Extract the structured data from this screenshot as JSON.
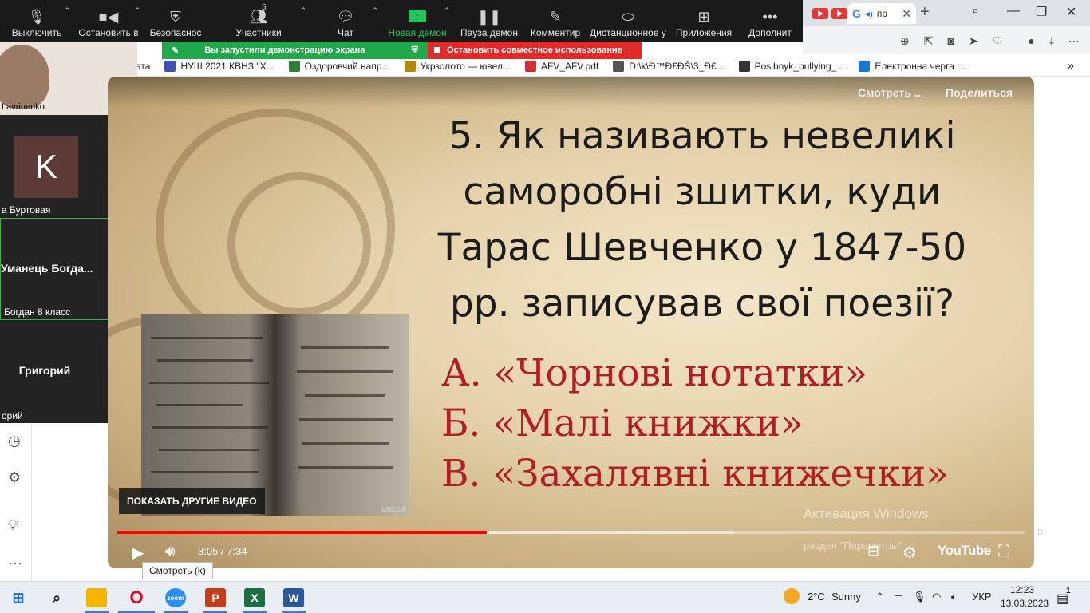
{
  "zoom_toolbar": {
    "items": [
      {
        "label": "Выключить",
        "icon": "mic-icon"
      },
      {
        "label": "Остановить в",
        "icon": "video-camera-icon"
      },
      {
        "label": "Безопаснос",
        "icon": "shield-icon"
      },
      {
        "label": "Участники",
        "icon": "participants-icon",
        "count": "5"
      },
      {
        "label": "Чат",
        "icon": "chat-icon"
      },
      {
        "label": "Новая демон",
        "icon": "share-screen-icon"
      },
      {
        "label": "Пауза демон",
        "icon": "pause-icon"
      },
      {
        "label": "Комментир",
        "icon": "pen-icon"
      },
      {
        "label": "Дистанционное у",
        "icon": "mouse-icon"
      },
      {
        "label": "Приложения",
        "icon": "apps-icon"
      },
      {
        "label": "Дополнит",
        "icon": "more-dots-icon"
      }
    ],
    "share_banner": "Вы запустили демонстрацию экрана",
    "stop_banner": "Остановить совместное использование",
    "accent_green": "#22c55e",
    "stop_red": "#e02b2b"
  },
  "participants": {
    "tile1_name": "Lavrinenko",
    "tile2_initial": "K",
    "tile2_name": "а Буртовая",
    "tile3_name": "Уманець  Богда...",
    "tile3_sub": "Богдан 8 класс",
    "tile4_name": "Григорий",
    "tile4_sub": "орий"
  },
  "browser": {
    "active_tab_title": "пр",
    "bookmarks": [
      {
        "label": "ата",
        "color": "#888888"
      },
      {
        "label": "НУШ 2021 КВНЗ \"Х...",
        "color": "#3f51b5"
      },
      {
        "label": "Оздоровчий напр...",
        "color": "#2e7d32"
      },
      {
        "label": "Укрзолото — ювел...",
        "color": "#b8860b"
      },
      {
        "label": "AFV_AFV.pdf",
        "color": "#d32f2f"
      },
      {
        "label": "D:\\k\\Ð™Ð£ÐŠ\\3_Ð£...",
        "color": "#555555"
      },
      {
        "label": "Posibnyk_bullying_...",
        "color": "#333333"
      },
      {
        "label": "Електронна черга :...",
        "color": "#1976d2"
      }
    ],
    "more_bookmarks": "»"
  },
  "video": {
    "top_right_watch": "Смотреть ...",
    "top_right_share": "Поделиться",
    "question_lines": [
      "5. Як називають невеликі",
      "саморобні зшитки, куди",
      "Тарас Шевченко у 1847-50",
      "рр. записував свої поезії?"
    ],
    "answers": [
      "А. «Чорнові нотатки»",
      "Б. «Малі книжки»",
      "В. «Захалявні книжечки»"
    ],
    "manuscript_watermark": "UNC.UA",
    "show_other_videos": "ПОКАЗАТЬ ДРУГИЕ ВИДЕО",
    "time": "3:05 / 7:34",
    "progress_played": 0.407,
    "progress_buffered": 0.68,
    "youtube_label": "YouTube",
    "activation_line1": "Активация Windows",
    "activation_line2": "раздел \"Параметры\"",
    "activation_end": "в",
    "tooltip": "Смотреть (k)",
    "answer_color": "#b11f24"
  },
  "taskbar": {
    "weather_temp": "2°C",
    "weather_text": "Sunny",
    "language": "УКР",
    "time": "12:23",
    "date": "13.03.2023",
    "notification_count": "1"
  }
}
